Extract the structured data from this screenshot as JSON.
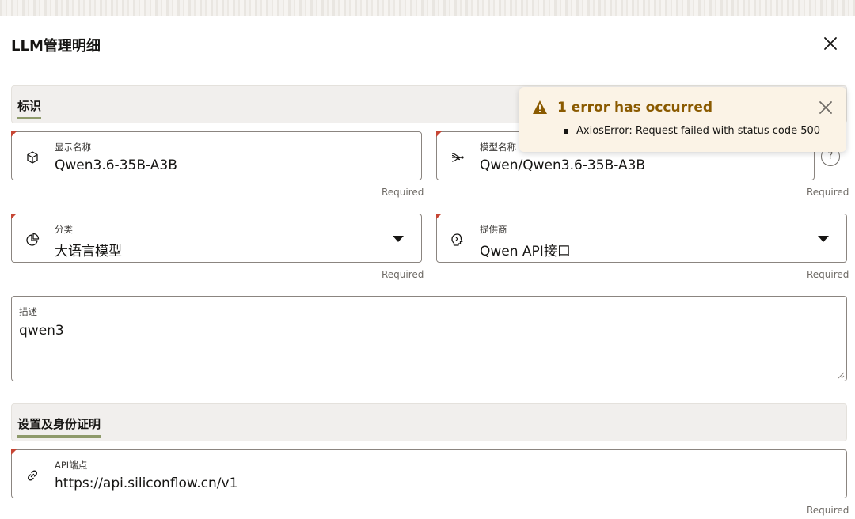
{
  "header": {
    "title": "LLM管理明细"
  },
  "sections": {
    "identity": {
      "title": "标识"
    },
    "settings": {
      "title": "设置及身份证明"
    }
  },
  "fields": {
    "display_name": {
      "label": "显示名称",
      "value": "Qwen3.6-35B-A3B",
      "icon": "cube-icon"
    },
    "model_name": {
      "label": "模型名称",
      "value": "Qwen/Qwen3.6-35B-A3B",
      "icon": "neural-network-icon"
    },
    "category": {
      "label": "分类",
      "value": "大语言模型",
      "icon": "pie-chart-icon"
    },
    "provider": {
      "label": "提供商",
      "value": "Qwen API接口",
      "icon": "ai-brain-icon"
    },
    "description": {
      "label": "描述",
      "value": "qwen3"
    },
    "api_endpoint": {
      "label": "API端点",
      "value": "https://api.siliconflow.cn/v1",
      "icon": "link-icon"
    }
  },
  "required_text": "Required",
  "help_label": "?",
  "toast": {
    "title": "1 error has occurred",
    "message": "AxiosError: Request failed with status code 500",
    "icon": "warning-icon"
  },
  "colors": {
    "required_flag": "#c74634",
    "section_underline": "#8e9a6b",
    "toast_bg": "#fbf3e6",
    "toast_title": "#8a5a00"
  }
}
